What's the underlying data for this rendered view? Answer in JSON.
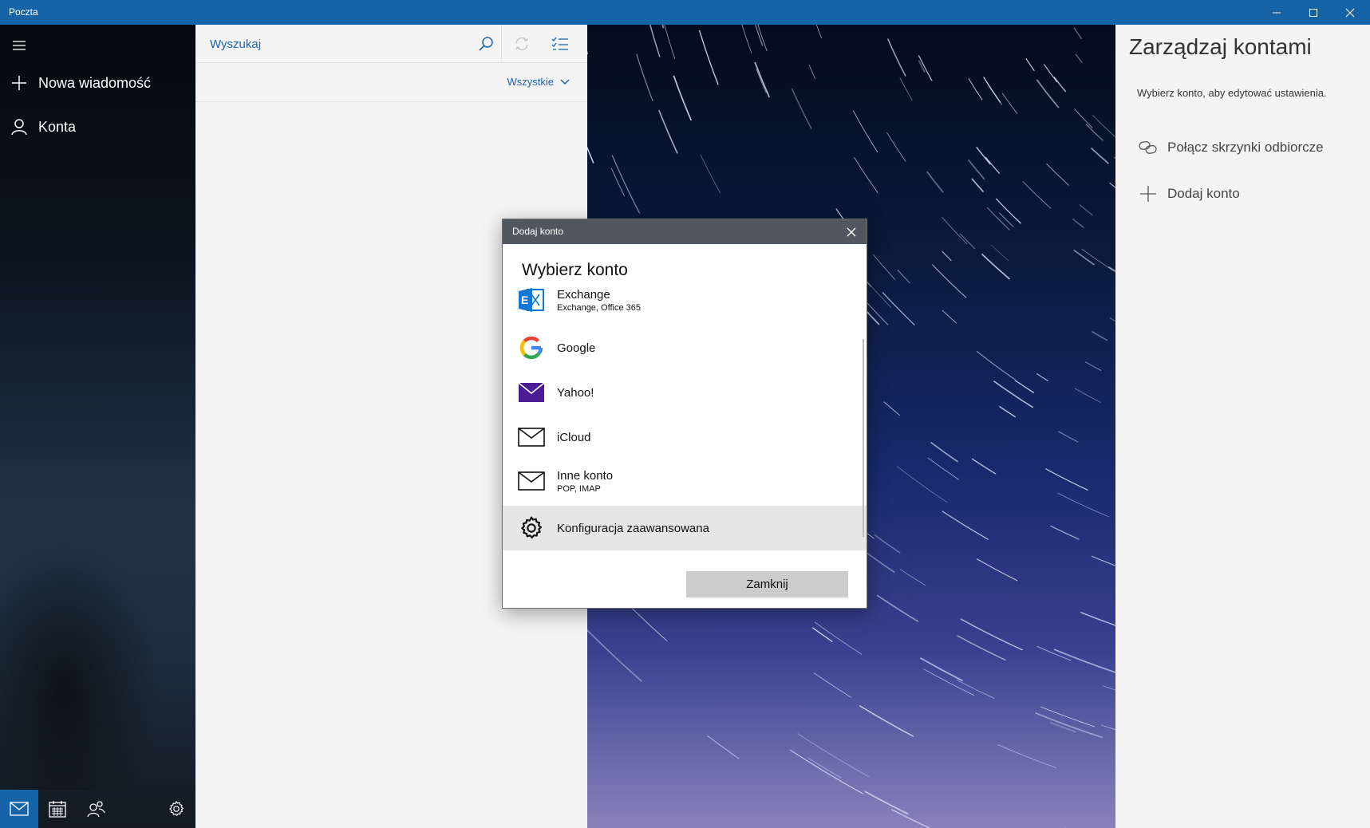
{
  "window": {
    "title": "Poczta"
  },
  "sidebar": {
    "new_message": "Nowa wiadomość",
    "accounts": "Konta"
  },
  "list": {
    "search_placeholder": "Wyszukaj",
    "filter_label": "Wszystkie"
  },
  "manage_accounts": {
    "title": "Zarządzaj kontami",
    "subtitle": "Wybierz konto, aby edytować ustawienia.",
    "link_inboxes": "Połącz skrzynki odbiorcze",
    "add_account": "Dodaj konto"
  },
  "dialog": {
    "title": "Dodaj konto",
    "heading": "Wybierz konto",
    "accounts": [
      {
        "name": "Exchange",
        "sub": "Exchange, Office 365",
        "icon": "exchange-icon"
      },
      {
        "name": "Google",
        "sub": "",
        "icon": "google-icon"
      },
      {
        "name": "Yahoo!",
        "sub": "",
        "icon": "yahoo-mail-icon"
      },
      {
        "name": "iCloud",
        "sub": "",
        "icon": "mail-envelope-icon"
      },
      {
        "name": "Inne konto",
        "sub": "POP, IMAP",
        "icon": "mail-envelope-icon"
      },
      {
        "name": "Konfiguracja zaawansowana",
        "sub": "",
        "icon": "gear-icon"
      }
    ],
    "close_label": "Zamknij"
  },
  "colors": {
    "accent": "#1664a8",
    "link": "#1a62ad",
    "exchange": "#0f78d4",
    "yahoo": "#4b1c95"
  }
}
